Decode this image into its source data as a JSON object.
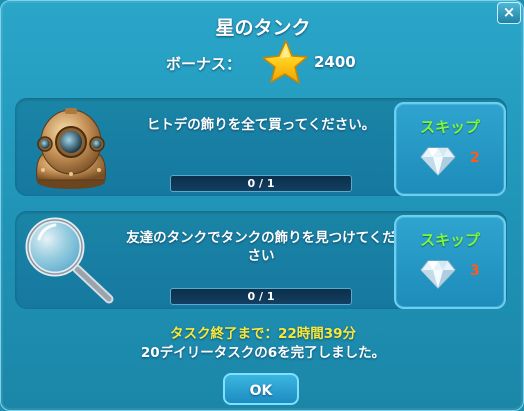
{
  "dialog": {
    "title": "星のタンク",
    "close_label": "×",
    "bonus_label": "ボーナス：",
    "bonus_value": "2400"
  },
  "tasks": [
    {
      "description": "ヒトデの飾りを全て買ってください。",
      "progress": "0 / 1",
      "progress_fraction": 0,
      "skip_label": "スキップ",
      "skip_cost": "2",
      "icon": "diving-helmet-icon"
    },
    {
      "description": "友達のタンクでタンクの飾りを見つけてください",
      "progress": "0 / 1",
      "progress_fraction": 0,
      "skip_label": "スキップ",
      "skip_cost": "3",
      "icon": "magnifying-glass-icon"
    }
  ],
  "footer": {
    "timer_text": "タスク終了まで：22時間39分",
    "daily_text": "20デイリータスクの6を完了しました。",
    "ok_label": "OK"
  },
  "colors": {
    "skip_green": "#7ef53f",
    "cost_orange": "#ff5a1a",
    "timer_yellow": "#f8e838"
  }
}
